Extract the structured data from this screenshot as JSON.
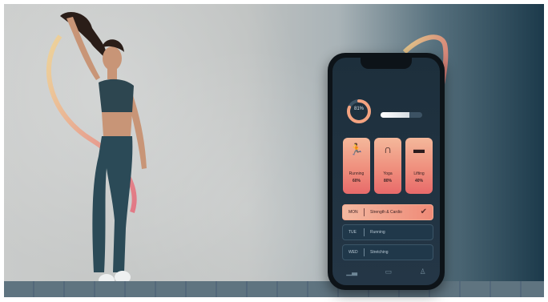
{
  "phone": {
    "ring": {
      "label": "81%",
      "progress": 0.81,
      "track_color": "#3c5263",
      "accent_color": "#f4a380"
    },
    "progress_bar": {
      "fill_fraction": 0.7
    },
    "cards": [
      {
        "icon": "running-icon",
        "name": "Running",
        "value": "60%"
      },
      {
        "icon": "yoga-icon",
        "name": "Yoga",
        "value": "80%"
      },
      {
        "icon": "dumbbell-icon",
        "name": "Lifting",
        "value": "40%"
      }
    ],
    "list": [
      {
        "label": "MON",
        "value": "Strength & Cardio",
        "active": true
      },
      {
        "label": "TUE",
        "value": "Running",
        "active": false
      },
      {
        "label": "WED",
        "value": "Stretching",
        "active": false
      }
    ],
    "nav": [
      "stats-icon",
      "home-icon",
      "profile-icon"
    ]
  },
  "colors": {
    "card_gradient_top": "#f4b89b",
    "card_gradient_bottom": "#e86a6a",
    "screen_bg": "#1d2f3c"
  }
}
